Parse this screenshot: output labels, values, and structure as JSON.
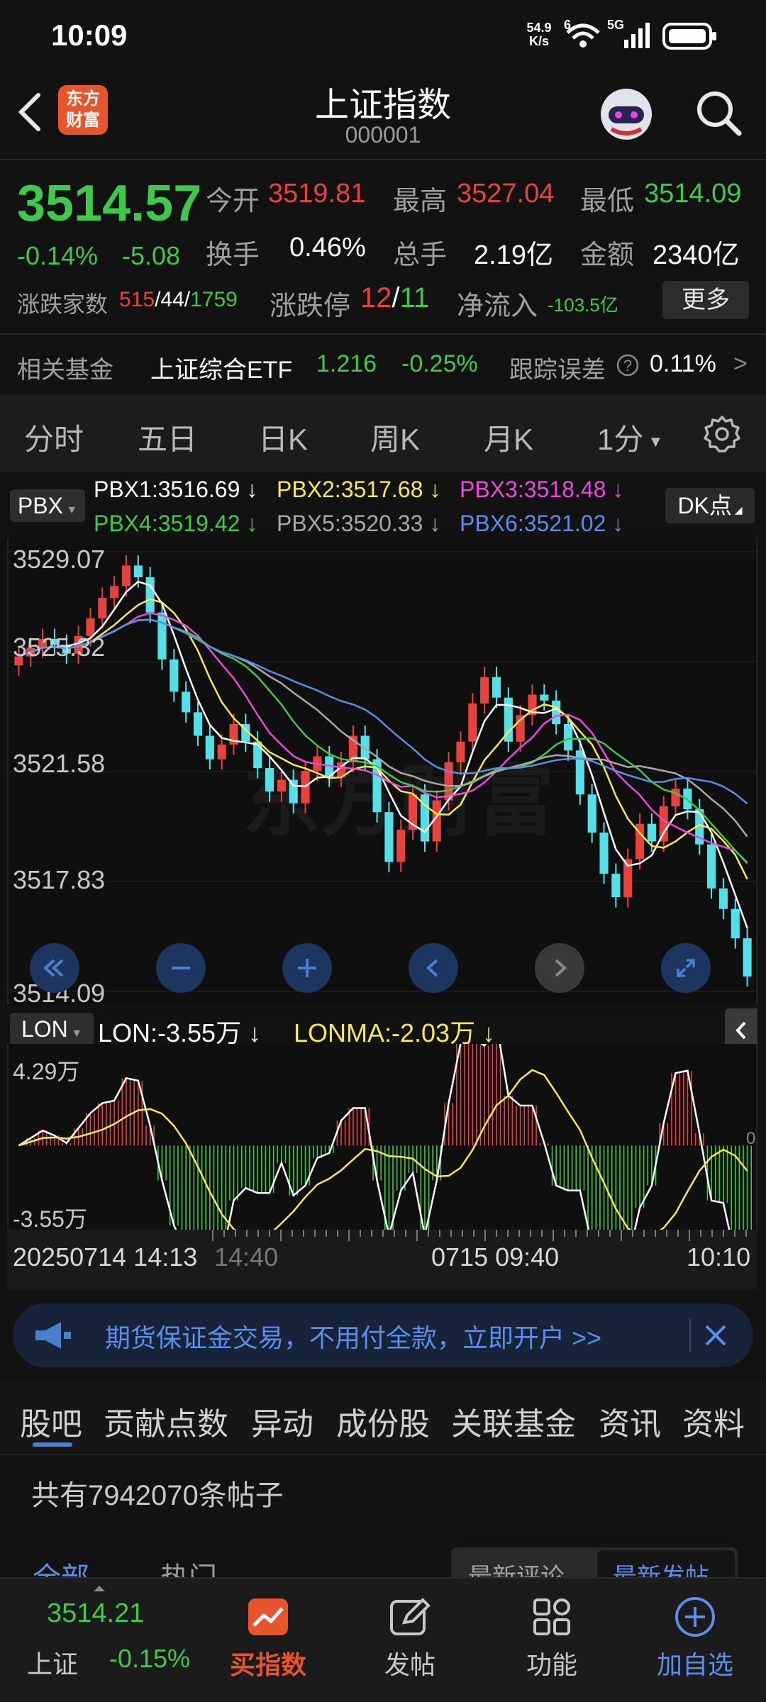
{
  "status": {
    "time": "10:09",
    "net_speed_value": "54.9",
    "net_speed_unit": "K/s",
    "wifi_badge": "6",
    "sim_badge": "5G"
  },
  "header": {
    "back_icon": "chevron-left-icon",
    "logo_line1": "东方",
    "logo_line2": "财富",
    "title": "上证指数",
    "code": "000001",
    "assistant_icon": "robot-avatar-icon",
    "search_icon": "search-icon"
  },
  "quote": {
    "price": "3514.57",
    "change_pct": "-0.14%",
    "change": "-5.08",
    "open_label": "今开",
    "open": "3519.81",
    "high_label": "最高",
    "high": "3527.04",
    "low_label": "最低",
    "low": "3514.09",
    "turnover_label": "换手",
    "turnover": "0.46%",
    "volume_label": "总手",
    "volume": "2.19亿",
    "amount_label": "金额",
    "amount": "2340亿",
    "breadth_label": "涨跌家数",
    "up_count": "515",
    "flat_count": "44",
    "down_count": "1759",
    "limit_label": "涨跌停",
    "limit_up": "12",
    "limit_down": "11",
    "inflow_label": "净流入",
    "inflow": "-103.5亿",
    "more_label": "更多"
  },
  "fund": {
    "label": "相关基金",
    "name": "上证综合ETF",
    "price": "1.216",
    "change": "-0.25%",
    "error_label": "跟踪误差",
    "error_value": "0.11%",
    "chevron": ">"
  },
  "period_tabs": [
    "分时",
    "五日",
    "日K",
    "周K",
    "月K"
  ],
  "period_active": "1分",
  "settings_icon": "gear-icon",
  "kline": {
    "indicator": "PBX",
    "dk_label": "DK点",
    "legend": [
      {
        "text": "PBX1:3516.69 ↓",
        "color": "#ffffff"
      },
      {
        "text": "PBX2:3517.68 ↓",
        "color": "#f5e94c"
      },
      {
        "text": "PBX3:3518.48 ↓",
        "color": "#e84ad8"
      },
      {
        "text": "PBX4:3519.42 ↓",
        "color": "#3fc84a"
      },
      {
        "text": "PBX5:3520.33 ↓",
        "color": "#a8a8a8"
      },
      {
        "text": "PBX6:3521.02 ↓",
        "color": "#5a8ee8"
      }
    ],
    "y_labels": [
      "3529.07",
      "3525.32",
      "3521.58",
      "3517.83",
      "3514.09"
    ],
    "watermark": "东方财富",
    "controls": [
      "double-chevron-left-icon",
      "zoom-out-icon",
      "zoom-in-icon",
      "chevron-left-icon",
      "chevron-right-icon",
      "expand-icon"
    ]
  },
  "lon": {
    "indicator": "LON",
    "lon_value": "LON:-3.55万 ↓",
    "lonma_value": "LONMA:-2.03万 ↓",
    "y_top": "4.29万",
    "y_zero": "0",
    "y_bottom": "-3.55万",
    "collapse_icon": "chevron-left-icon"
  },
  "time_axis": {
    "start": "20250714 14:13",
    "mid_faded": "14:40",
    "mid": "0715 09:40",
    "end": "10:10"
  },
  "ad": {
    "text": "期货保证金交易，不用付全款，立即开户 >>",
    "icon": "megaphone-icon",
    "close_icon": "close-icon"
  },
  "content_tabs": [
    "股吧",
    "贡献点数",
    "异动",
    "成份股",
    "关联基金",
    "资讯",
    "资料"
  ],
  "post_count": "共有7942070条帖子",
  "sub_tabs": {
    "all": "全部",
    "hot": "热门",
    "latest_comment": "最新评论",
    "latest_post": "最新发帖"
  },
  "bottom_nav": {
    "index_price": "3514.21",
    "index_name": "上证",
    "index_change": "-0.15%",
    "buy_label": "买指数",
    "post_label": "发帖",
    "func_label": "功能",
    "add_label": "加自选"
  },
  "chart_data": {
    "type": "candlestick",
    "interval": "1分",
    "ylim": [
      3514.09,
      3529.07
    ],
    "indicators": [
      "PBX1",
      "PBX2",
      "PBX3",
      "PBX4",
      "PBX5",
      "PBX6"
    ],
    "latest_values": {
      "PBX1": 3516.69,
      "PBX2": 3517.68,
      "PBX3": 3518.48,
      "PBX4": 3519.42,
      "PBX5": 3520.33,
      "PBX6": 3521.02
    },
    "close": [
      3525.5,
      3525.8,
      3526.1,
      3525.9,
      3525.6,
      3526.2,
      3526.8,
      3527.5,
      3527.9,
      3528.6,
      3528.2,
      3527.0,
      3525.4,
      3524.3,
      3523.6,
      3522.8,
      3522.0,
      3522.5,
      3523.2,
      3522.6,
      3521.7,
      3520.9,
      3521.3,
      3520.5,
      3521.6,
      3522.1,
      3521.4,
      3521.9,
      3522.8,
      3522.0,
      3520.2,
      3518.5,
      3519.6,
      3520.8,
      3519.2,
      3520.6,
      3521.9,
      3522.6,
      3523.9,
      3524.8,
      3524.1,
      3522.6,
      3523.5,
      3524.2,
      3524.0,
      3523.2,
      3522.3,
      3520.8,
      3519.5,
      3518.1,
      3517.3,
      3518.6,
      3519.8,
      3519.2,
      3520.4,
      3521.0,
      3520.3,
      3519.1,
      3517.6,
      3516.9,
      3515.9,
      3514.6
    ],
    "lon_ylim": [
      -3.55,
      4.29
    ],
    "lon_unit": "万",
    "lon_latest": -3.55,
    "lonma_latest": -2.03,
    "x_labels": [
      "20250714 14:13",
      "0715 09:40",
      "10:10"
    ]
  }
}
